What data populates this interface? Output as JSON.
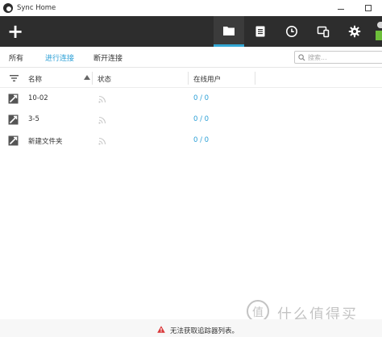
{
  "window": {
    "title": "Sync Home"
  },
  "toolbar": {
    "add_label": "+",
    "tabs": [
      {
        "icon": "folder-icon",
        "active": true
      },
      {
        "icon": "document-icon",
        "active": false
      },
      {
        "icon": "clock-icon",
        "active": false
      },
      {
        "icon": "devices-icon",
        "active": false
      },
      {
        "icon": "gear-icon",
        "active": false
      }
    ]
  },
  "filter": {
    "tabs": [
      "所有",
      "进行连接",
      "断开连接"
    ],
    "active_tab": "进行连接",
    "search_placeholder": "搜索..."
  },
  "table": {
    "headers": {
      "name": "名称",
      "status": "状态",
      "online_users": "在线用户"
    },
    "rows": [
      {
        "name": "10-02",
        "online_users": "0 / 0"
      },
      {
        "name": "3-5",
        "online_users": "0 / 0"
      },
      {
        "name": "新建文件夹",
        "online_users": "0 / 0"
      }
    ]
  },
  "status": {
    "message": "无法获取追踪器列表。"
  },
  "watermark": {
    "text": "什么值得买"
  },
  "colors": {
    "accent": "#2a9fd6",
    "toolbar_bg": "#2d2d2d",
    "warning": "#d9383a"
  }
}
